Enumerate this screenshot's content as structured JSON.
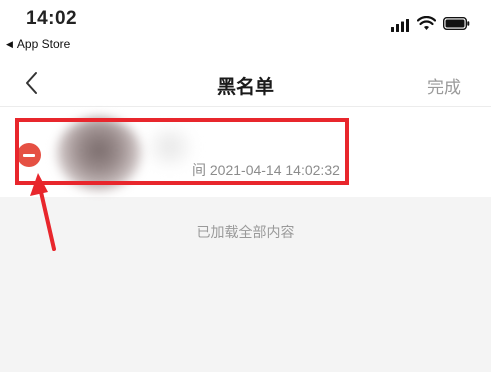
{
  "status_bar": {
    "time": "14:02",
    "back_app_label": "App Store",
    "back_app_icon": "triangle-left-icon",
    "signal_icon": "cellular-signal-icon",
    "wifi_icon": "wifi-icon",
    "battery_icon": "battery-icon"
  },
  "nav": {
    "back_icon": "chevron-left-icon",
    "title": "黑名单",
    "done_label": "完成"
  },
  "list": {
    "items": [
      {
        "avatar": "blurred-avatar",
        "time_text": "间 2021-04-14 14:02:32",
        "remove_icon": "minus-circle-icon"
      }
    ]
  },
  "footer": {
    "loaded_text": "已加载全部内容"
  },
  "annotation": {
    "highlight_color": "#e8262c",
    "arrow_color": "#e8262c"
  },
  "colors": {
    "remove_red": "#e55043",
    "done_gray": "#9a9a9a",
    "background": "#f4f4f4"
  }
}
